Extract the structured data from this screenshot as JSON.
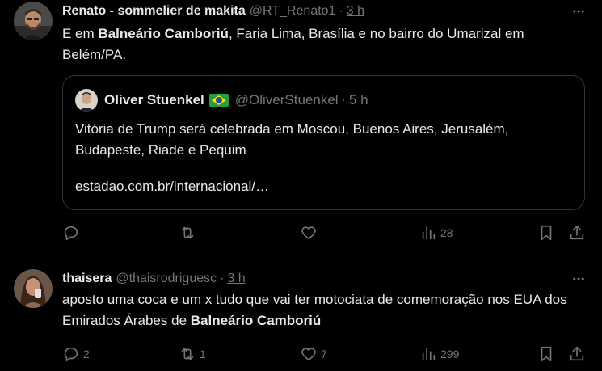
{
  "tweets": [
    {
      "name": "Renato - sommelier de makita",
      "handle": "@RT_Renato1",
      "separator": "·",
      "time": "3 h",
      "text_parts": [
        {
          "t": "E em ",
          "b": false
        },
        {
          "t": "Balneário Camboriú",
          "b": true
        },
        {
          "t": ", Faria Lima, Brasília e no bairro do Umarizal em Belém/PA.",
          "b": false
        }
      ],
      "quote": {
        "name": "Oliver Stuenkel",
        "flag": "Brazil flag",
        "handle": "@OliverStuenkel",
        "separator": "·",
        "time": "5 h",
        "text": "Vitória de Trump será celebrada em Moscou, Buenos Aires, Jerusalém, Budapeste, Riade e Pequim",
        "link": "estadao.com.br/internacional/…"
      },
      "stats": {
        "replies": "",
        "retweets": "",
        "likes": "",
        "views": "28"
      }
    },
    {
      "name": "thaisera",
      "handle": "@thaisrodriguesc",
      "separator": "·",
      "time": "3 h",
      "text_parts": [
        {
          "t": "aposto uma coca e um x tudo que vai ter motociata de comemoração nos EUA dos Emirados Árabes de ",
          "b": false
        },
        {
          "t": "Balneário Camboriú",
          "b": true
        }
      ],
      "stats": {
        "replies": "2",
        "retweets": "1",
        "likes": "7",
        "views": "299"
      }
    }
  ],
  "icons": {
    "more": "more-icon",
    "reply": "reply-icon",
    "retweet": "retweet-icon",
    "like": "heart-icon",
    "views": "views-icon",
    "bookmark": "bookmark-icon",
    "share": "share-icon"
  },
  "colors": {
    "background": "#000000",
    "text": "#e7e9ea",
    "secondary": "#71767b",
    "border": "#2f3336"
  }
}
